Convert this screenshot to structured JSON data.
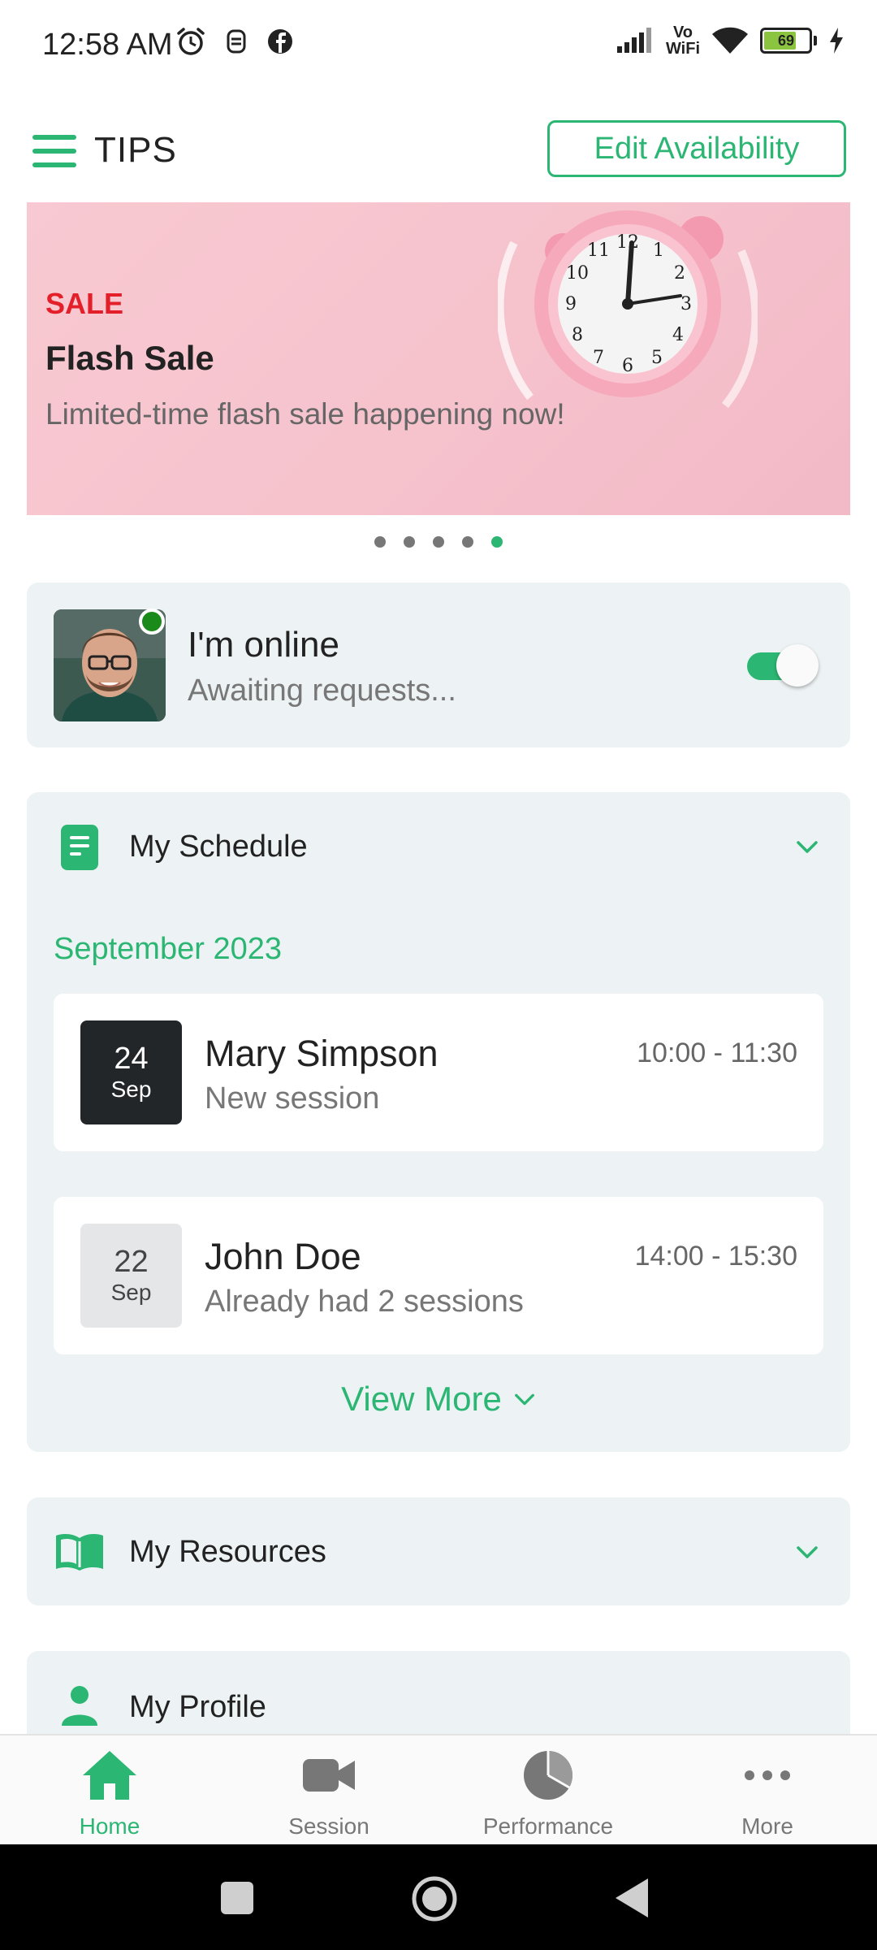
{
  "status_bar": {
    "time": "12:58 AM",
    "vowifi": "Vo\nWiFi",
    "battery": "69"
  },
  "app_bar": {
    "title": "TIPS",
    "edit_button": "Edit Availability"
  },
  "banner": {
    "tag": "SALE",
    "title": "Flash Sale",
    "subtitle": "Limited-time flash sale happening now!",
    "page_count": 5,
    "active_page": 5
  },
  "online": {
    "title": "I'm online",
    "subtitle": "Awaiting requests...",
    "toggle_on": true
  },
  "schedule": {
    "title": "My Schedule",
    "month": "September 2023",
    "sessions": [
      {
        "day": "24",
        "month": "Sep",
        "name": "Mary Simpson",
        "note": "New session",
        "time": "10:00 - 11:30"
      },
      {
        "day": "22",
        "month": "Sep",
        "name": "John Doe",
        "note": "Already had 2 sessions",
        "time": "14:00 - 15:30"
      }
    ],
    "view_more": "View More"
  },
  "resources": {
    "title": "My Resources"
  },
  "profile": {
    "title": "My Profile"
  },
  "bottom_nav": [
    {
      "label": "Home",
      "icon": "home-icon",
      "active": true
    },
    {
      "label": "Session",
      "icon": "video-camera-icon",
      "active": false
    },
    {
      "label": "Performance",
      "icon": "pie-chart-icon",
      "active": false
    },
    {
      "label": "More",
      "icon": "more-dots-icon",
      "active": false
    }
  ],
  "colors": {
    "accent": "#2bb673",
    "sale": "#e3202a",
    "card_bg": "#edf2f4",
    "online": "#1a8a1a"
  }
}
